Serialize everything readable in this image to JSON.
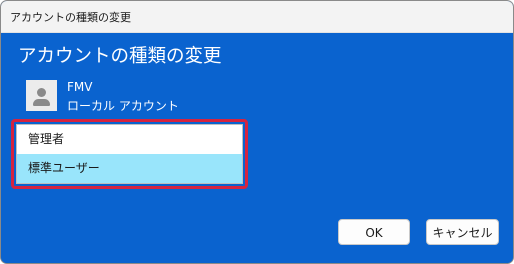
{
  "window": {
    "title": "アカウントの種類の変更"
  },
  "dialog": {
    "heading": "アカウントの種類の変更",
    "user": {
      "name": "FMV",
      "account_type": "ローカル アカウント",
      "avatar_icon": "user-avatar-icon"
    },
    "account_types": [
      {
        "label": "管理者",
        "selected": false
      },
      {
        "label": "標準ユーザー",
        "selected": true
      }
    ],
    "buttons": {
      "ok_label": "OK",
      "cancel_label": "キャンセル"
    }
  },
  "colors": {
    "dialog_background": "#0a63cf",
    "selection_highlight": "#99e5fb",
    "annotation_border": "#d6243f"
  }
}
